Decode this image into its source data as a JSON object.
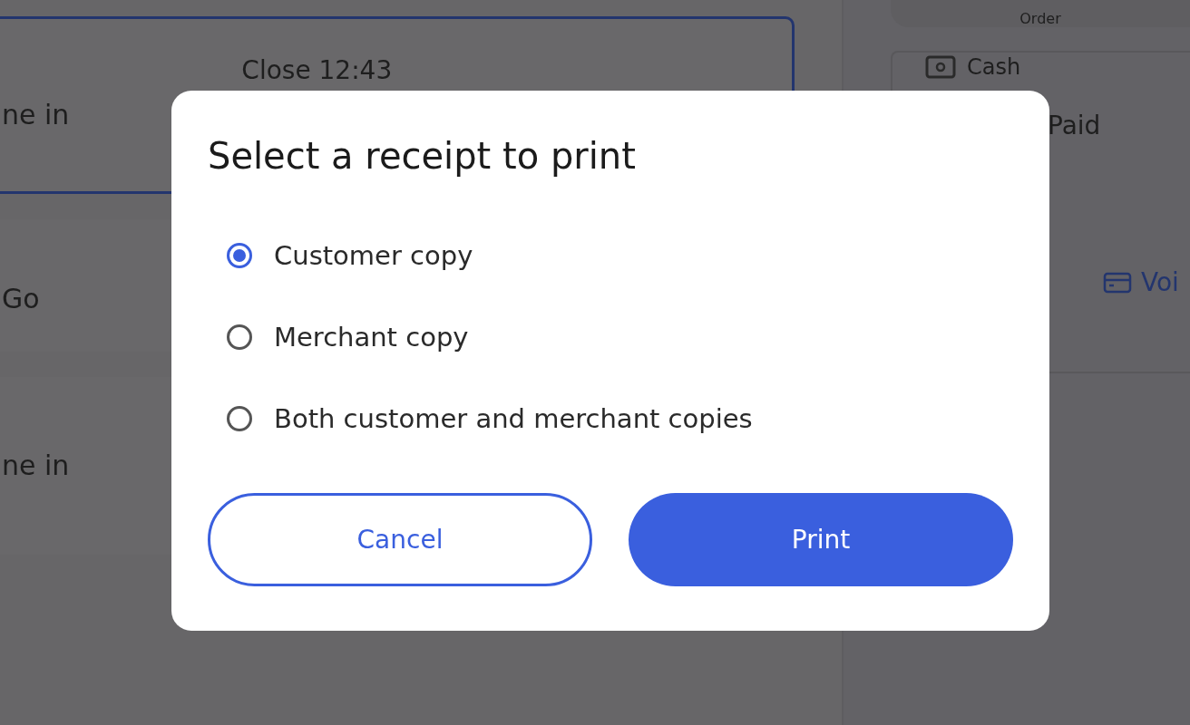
{
  "background": {
    "cards": [
      {
        "text": "ne in",
        "detail": "Close 12:43",
        "selected": true
      },
      {
        "text": "Go",
        "selected": false
      },
      {
        "text": "ne in",
        "selected": false
      }
    ],
    "order_button": "Order",
    "payment": {
      "method": "Cash",
      "status": "Paid",
      "action": "Voi"
    }
  },
  "dialog": {
    "title": "Select a receipt to print",
    "options": [
      {
        "label": "Customer copy",
        "selected": true
      },
      {
        "label": "Merchant copy",
        "selected": false
      },
      {
        "label": "Both customer and merchant copies",
        "selected": false
      }
    ],
    "buttons": [
      {
        "label": "Cancel",
        "kind": "secondary"
      },
      {
        "label": "Print",
        "kind": "primary"
      }
    ]
  }
}
